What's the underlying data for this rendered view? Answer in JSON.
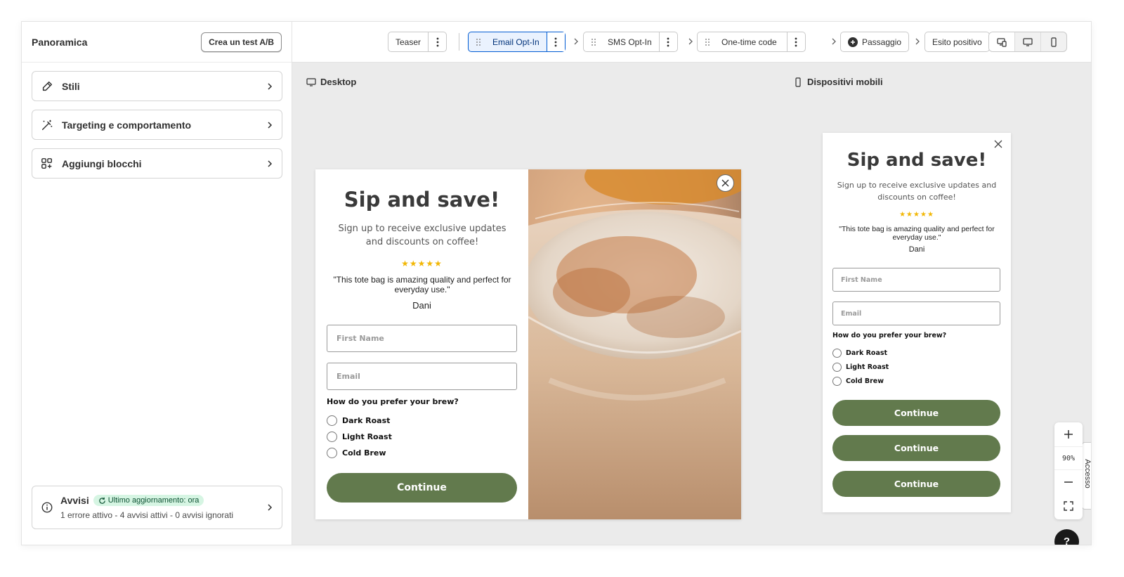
{
  "left": {
    "title": "Panoramica",
    "ab_button": "Crea un test A/B",
    "items": [
      {
        "label": "Stili",
        "icon": "paint-brush-icon"
      },
      {
        "label": "Targeting e comportamento",
        "icon": "magic-wand-icon"
      },
      {
        "label": "Aggiungi blocchi",
        "icon": "blocks-icon"
      }
    ],
    "alerts": {
      "title": "Avvisi",
      "badge": "Ultimo aggiornamento: ora",
      "summary": "1 errore attivo - 4 avvisi attivi - 0 avvisi ignorati"
    }
  },
  "toolbar": {
    "steps": [
      {
        "label": "Teaser"
      },
      {
        "label": "Email Opt-In",
        "active": true
      },
      {
        "label": "SMS Opt-In"
      },
      {
        "label": "One-time code"
      }
    ],
    "add_step": "Passaggio",
    "success": "Esito positivo"
  },
  "canvas": {
    "desktop_label": "Desktop",
    "mobile_label": "Dispositivi mobili",
    "zoom": "90%",
    "side_tab": "Accesso",
    "help": "?"
  },
  "popup": {
    "title": "Sip and save!",
    "subtitle": "Sign up to receive exclusive updates and discounts on coffee!",
    "stars": "★★★★★",
    "rating": 5,
    "quote": "\"This tote bag is amazing quality and perfect for everyday use.\"",
    "author": "Dani",
    "first_name_placeholder": "First Name",
    "email_placeholder": "Email",
    "question": "How do you prefer your brew?",
    "options": [
      "Dark Roast",
      "Light Roast",
      "Cold Brew"
    ],
    "cta": "Continue"
  },
  "colors": {
    "accent_green": "#627a4d",
    "active_blue": "#005bd3",
    "star": "#f2b705"
  }
}
